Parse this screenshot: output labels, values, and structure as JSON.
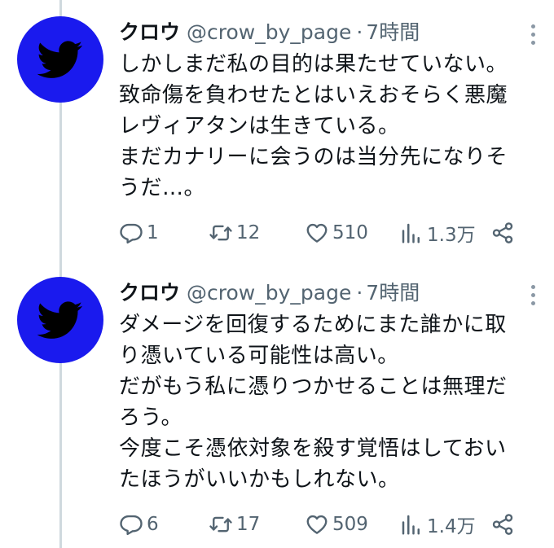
{
  "tweets": [
    {
      "name": "クロウ",
      "handle": "@crow_by_page",
      "separator": "·",
      "time": "7時間",
      "lines": [
        "しかしまだ私の目的は果たせていない。",
        "致命傷を負わせたとはいえおそらく悪魔",
        "レヴィアタンは生きている。",
        "まだカナリーに会うのは当分先になりそ",
        "うだ…。"
      ],
      "replies": "1",
      "retweets": "12",
      "likes": "510",
      "views": "1.3万"
    },
    {
      "name": "クロウ",
      "handle": "@crow_by_page",
      "separator": "·",
      "time": "7時間",
      "lines": [
        "ダメージを回復するためにまた誰かに取",
        "り憑いている可能性は高い。",
        "だがもう私に憑りつかせることは無理だ",
        "ろう。",
        "今度こそ憑依対象を殺す覚悟はしておい",
        "たほうがいいかもしれない。"
      ],
      "replies": "6",
      "retweets": "17",
      "likes": "509",
      "views": "1.4万"
    }
  ],
  "icons": {
    "avatar": "bird-icon",
    "more": "more-icon",
    "reply": "reply-icon",
    "retweet": "retweet-icon",
    "like": "heart-icon",
    "views": "views-icon",
    "share": "share-icon"
  },
  "colors": {
    "avatar_bg": "#1a1aee",
    "text": "#0f1419",
    "secondary": "#536471",
    "thread_line": "#cfd9de"
  }
}
